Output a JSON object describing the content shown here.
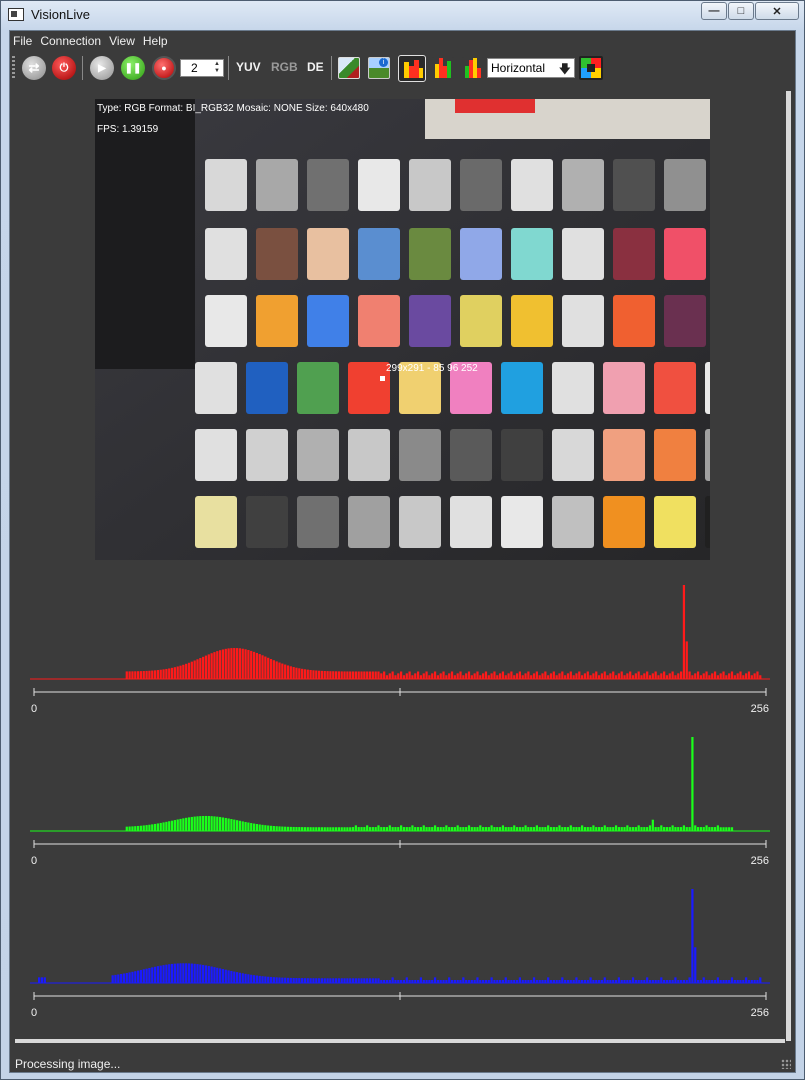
{
  "window": {
    "title": "VisionLive"
  },
  "menubar": {
    "items": [
      "File",
      "Connection",
      "View",
      "Help"
    ]
  },
  "toolbar": {
    "frame_step_value": "2",
    "mode_buttons": {
      "yuv": "YUV",
      "rgb": "RGB",
      "de": "DE"
    },
    "layout_select": "Horizontal"
  },
  "image_info": {
    "header": "Type: RGB Format: BI_RGB32 Mosaic: NONE Size: 640x480",
    "fps": "FPS: 1.39159",
    "pixel_readout": "299x291 - 85 96 252"
  },
  "histograms": [
    {
      "name": "red",
      "color": "#ff1a1a",
      "axis_min": "0",
      "axis_max": "256"
    },
    {
      "name": "green",
      "color": "#1aff1a",
      "axis_min": "0",
      "axis_max": "256"
    },
    {
      "name": "blue",
      "color": "#1a1aff",
      "axis_min": "0",
      "axis_max": "256"
    }
  ],
  "status": {
    "text": "Processing image..."
  },
  "colors": {
    "background": "#3b3b3b",
    "window_frame": "#c6d6ea"
  }
}
